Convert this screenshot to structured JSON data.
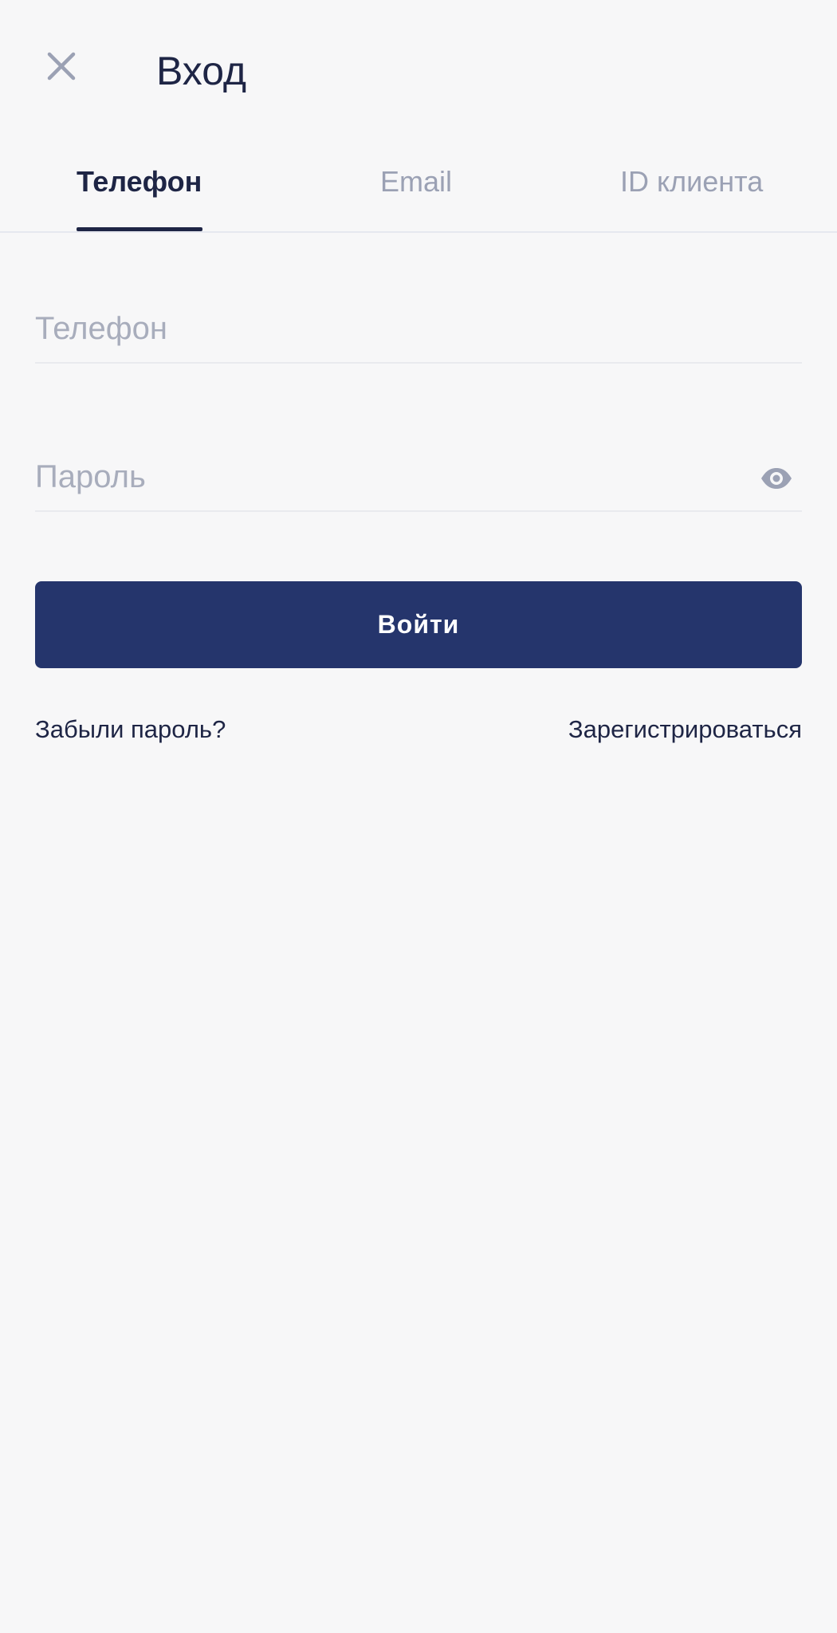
{
  "header": {
    "title": "Вход",
    "close_icon": "close-icon"
  },
  "tabs": [
    {
      "label": "Телефон",
      "active": true
    },
    {
      "label": "Email",
      "active": false
    },
    {
      "label": "ID клиента",
      "active": false
    }
  ],
  "form": {
    "phone": {
      "placeholder": "Телефон",
      "value": ""
    },
    "password": {
      "placeholder": "Пароль",
      "value": "",
      "toggle_icon": "eye-icon"
    },
    "submit_label": "Войти"
  },
  "links": {
    "forgot": "Забыли пароль?",
    "register": "Зарегистрироваться"
  },
  "colors": {
    "background": "#f7f7f8",
    "primary": "#25356c",
    "text_dark": "#1e2545",
    "text_muted": "#9ba1b4"
  }
}
